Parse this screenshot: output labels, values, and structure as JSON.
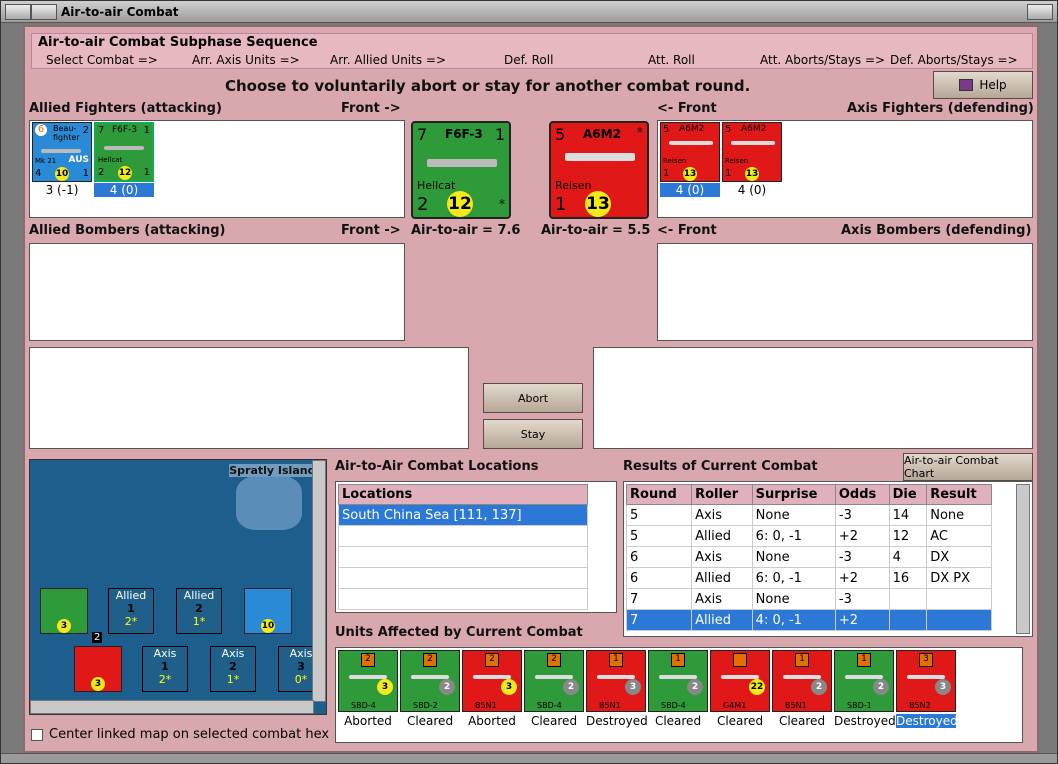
{
  "window": {
    "title": "Air-to-air Combat"
  },
  "sequence": {
    "header": "Air-to-air Combat Subphase Sequence",
    "steps": [
      "Select Combat =>",
      "Arr. Axis Units =>",
      "Arr. Allied Units =>",
      "Def. Roll",
      "Att. Roll",
      "Att. Aborts/Stays =>",
      "Def. Aborts/Stays =>"
    ]
  },
  "instruction": "Choose to voluntarily abort or stay for another combat round.",
  "help_label": "Help",
  "allied_fighters": {
    "title": "Allied Fighters (attacking)",
    "front": "Front ->",
    "units": [
      {
        "name": "Beau-fighter",
        "top_left": "6",
        "top_right": "2",
        "sub": "Mk 21",
        "nation": "AUS",
        "bottom_left": "4",
        "factor": "10",
        "bottom_right": "1",
        "caption": "3 (-1)"
      },
      {
        "name": "F6F-3",
        "top_left": "7",
        "top_right": "1",
        "sub": "Hellcat",
        "bottom_left": "2",
        "factor": "12",
        "bottom_right": "1",
        "caption": "4 (0)"
      }
    ]
  },
  "axis_fighters": {
    "title": "Axis Fighters (defending)",
    "front": "<- Front",
    "units": [
      {
        "name": "A6M2",
        "top_left": "5",
        "sub": "Reisen",
        "bottom_left": "1",
        "factor": "13",
        "caption": "4 (0)"
      },
      {
        "name": "A6M2",
        "top_left": "5",
        "sub": "Reisen",
        "bottom_left": "1",
        "factor": "13",
        "caption": "4 (0)"
      }
    ]
  },
  "front_allied": {
    "name": "F6F-3",
    "top_left": "7",
    "top_right": "1",
    "sub": "Hellcat",
    "bottom_left": "2",
    "factor": "12",
    "star": "*"
  },
  "front_axis": {
    "name": "A6M2",
    "top_left": "5",
    "sub": "Reisen",
    "bottom_left": "1",
    "factor": "13",
    "star": "*"
  },
  "allied_bombers": {
    "title": "Allied Bombers (attacking)",
    "front": "Front ->"
  },
  "axis_bombers": {
    "title": "Axis Bombers (defending)",
    "front": "<- Front"
  },
  "air_to_air_allied": "Air-to-air = 7.6",
  "air_to_air_axis": "Air-to-air = 5.5",
  "abort_label": "Abort",
  "stay_label": "Stay",
  "map": {
    "label": "Spratly Islands",
    "allied_cells": [
      {
        "label": "Allied",
        "num": "1",
        "sub": "2*"
      },
      {
        "label": "Allied",
        "num": "2",
        "sub": "1*"
      }
    ],
    "axis_cells": [
      {
        "label": "Axis",
        "num": "1",
        "sub": "2*"
      },
      {
        "label": "Axis",
        "num": "2",
        "sub": "1*"
      },
      {
        "label": "Axis",
        "num": "3",
        "sub": "0*"
      }
    ],
    "badge_2": "2"
  },
  "center_map_label": "Center linked map on selected combat hex",
  "locations": {
    "title": "Air-to-Air Combat Locations",
    "header": "Locations",
    "rows": [
      "South China Sea [111, 137]"
    ]
  },
  "results": {
    "title": "Results of Current Combat",
    "chart_button": "Air-to-air Combat Chart",
    "columns": [
      "Round",
      "Roller",
      "Surprise",
      "Odds",
      "Die",
      "Result"
    ],
    "rows": [
      [
        "5",
        "Axis",
        "None",
        "-3",
        "14",
        "None"
      ],
      [
        "5",
        "Allied",
        "6: 0, -1",
        "+2",
        "12",
        "AC"
      ],
      [
        "6",
        "Axis",
        "None",
        "-3",
        "4",
        "DX"
      ],
      [
        "6",
        "Allied",
        "6: 0, -1",
        "+2",
        "16",
        "DX PX"
      ],
      [
        "7",
        "Axis",
        "None",
        "-3",
        "",
        ""
      ],
      [
        "7",
        "Allied",
        "4: 0, -1",
        "+2",
        "",
        ""
      ]
    ],
    "selected_row": 5
  },
  "affected": {
    "title": "Units Affected by Current Combat",
    "units": [
      {
        "name": "SBD-4",
        "box": "2",
        "factor": "3",
        "color": "#2f9a3a",
        "factor_type": "yellow",
        "caption": "Aborted"
      },
      {
        "name": "SBD-2",
        "box": "2",
        "factor": "2",
        "color": "#2f9a3a",
        "factor_type": "grey",
        "caption": "Cleared"
      },
      {
        "name": "B5N1",
        "box": "2",
        "factor": "3",
        "color": "#e01818",
        "factor_type": "yellow",
        "caption": "Aborted"
      },
      {
        "name": "SBD-4",
        "box": "2",
        "factor": "2",
        "color": "#2f9a3a",
        "factor_type": "grey",
        "caption": "Cleared"
      },
      {
        "name": "B5N1",
        "box": "1",
        "factor": "3",
        "color": "#e01818",
        "factor_type": "grey",
        "caption": "Destroyed"
      },
      {
        "name": "SBD-4",
        "box": "1",
        "factor": "2",
        "color": "#2f9a3a",
        "factor_type": "grey",
        "caption": "Cleared"
      },
      {
        "name": "G4M1",
        "box": "",
        "factor": "22",
        "color": "#e01818",
        "factor_type": "yellow",
        "caption": "Cleared"
      },
      {
        "name": "B5N1",
        "box": "1",
        "factor": "2",
        "color": "#e01818",
        "factor_type": "grey",
        "caption": "Cleared"
      },
      {
        "name": "SBD-1",
        "box": "1",
        "factor": "2",
        "color": "#2f9a3a",
        "factor_type": "grey",
        "caption": "Destroyed"
      },
      {
        "name": "B5N2",
        "box": "3",
        "factor": "3",
        "color": "#e01818",
        "factor_type": "grey",
        "caption": "Destroyed"
      }
    ],
    "selected": 9
  },
  "colors": {
    "background": "#d9a8ae",
    "selection": "#2b78d6",
    "allied_green": "#2f9a3a",
    "axis_red": "#e01818",
    "aus_blue": "#2a8ad6",
    "factor_yellow": "#f2ea1a"
  }
}
